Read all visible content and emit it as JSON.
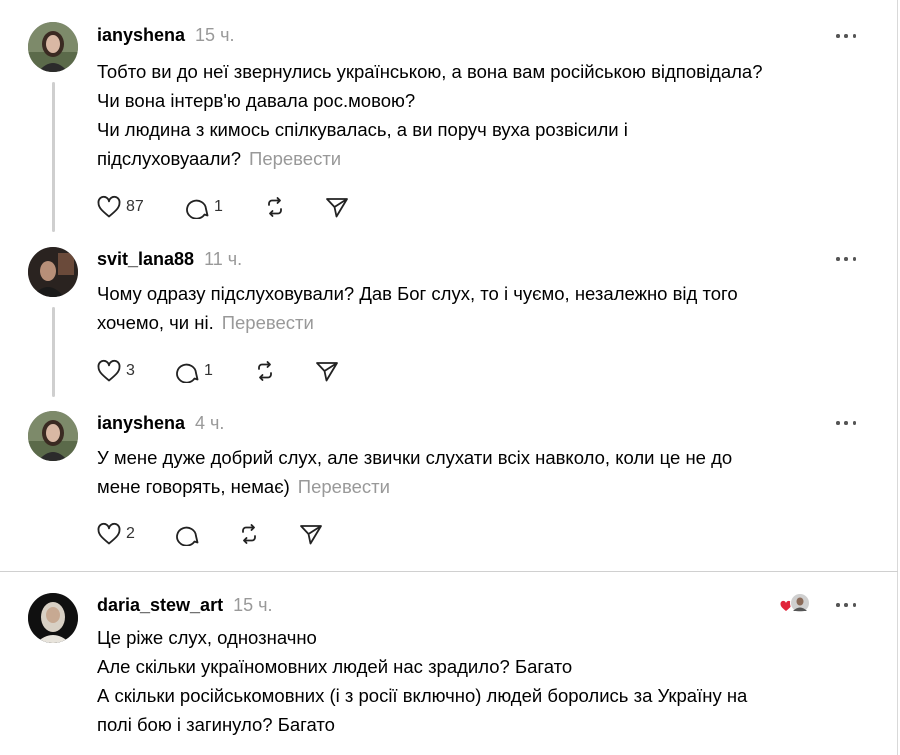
{
  "comments": [
    {
      "username": "ianyshena",
      "time": "15 ч.",
      "lines": [
        "Тобто ви до неї звернулись українською, а вона вам російською відповідала?",
        "Чи вона інтерв'ю давала рос.мовою?",
        "Чи людина з кимось спілкувалась, а ви поруч вуха розвісили і",
        "підслуховуаали?"
      ],
      "translate": "Перевести",
      "likes": "87",
      "replies": "1"
    },
    {
      "username": "svit_lana88",
      "time": "11 ч.",
      "lines": [
        "Чому одразу підслуховували? Дав Бог слух, то і чуємо, незалежно від того",
        "хочемо, чи ні."
      ],
      "translate": "Перевести",
      "likes": "3",
      "replies": "1"
    },
    {
      "username": "ianyshena",
      "time": "4 ч.",
      "lines": [
        "У мене дуже добрий слух, але звички слухати всіх навколо, коли це не до",
        "мене говорять, немає)"
      ],
      "translate": "Перевести",
      "likes": "2",
      "replies": ""
    },
    {
      "username": "daria_stew_art",
      "time": "15 ч.",
      "lines": [
        "Це ріже слух, однозначно",
        "Але скільки україномовних людей нас зрадило? Багато",
        "А скільки російськомовних (і з росії включно) людей боролись за Україну на",
        "полі бою і загинуло? Багато"
      ]
    }
  ],
  "icons": {
    "like": "heart-outline-icon",
    "reply": "speech-bubble-icon",
    "repost": "repost-arrows-icon",
    "share": "paper-plane-icon",
    "more": "more-dots-icon",
    "reaction_heart": "heart-filled-icon"
  },
  "colors": {
    "text": "#000000",
    "muted": "#999999",
    "thread_line": "#cfcfcf",
    "heart_red": "#e0243a"
  }
}
